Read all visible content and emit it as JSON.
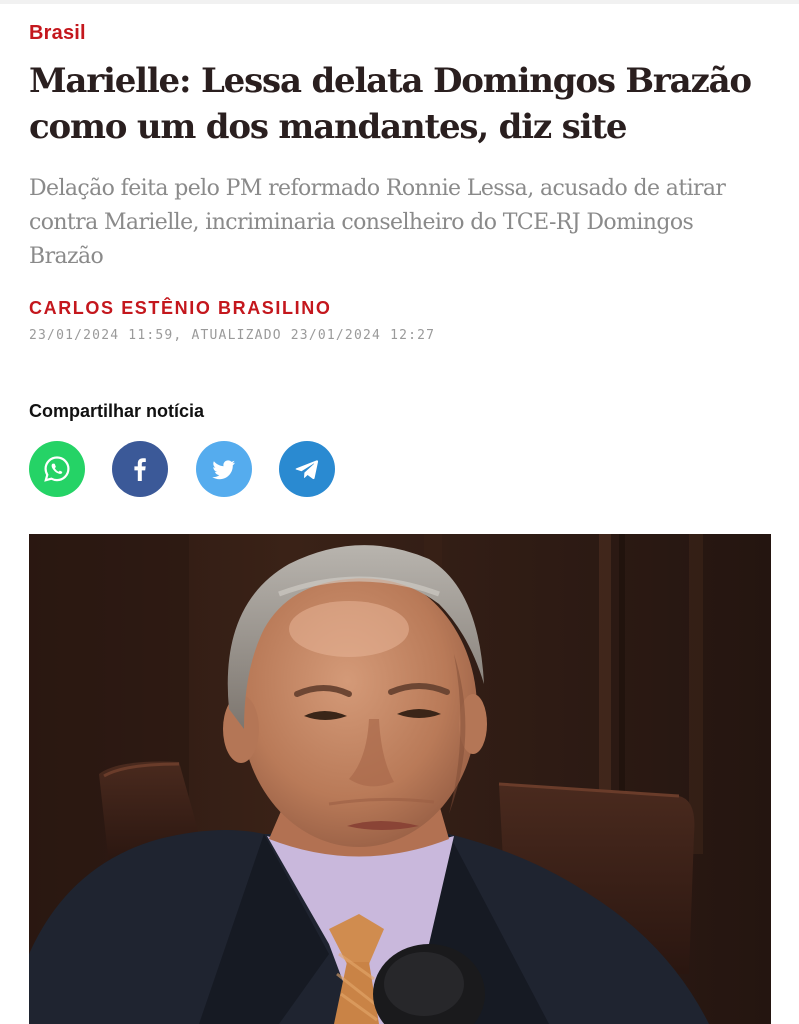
{
  "article": {
    "section": "Brasil",
    "headline": "Marielle: Lessa delata Domingos Brazão como um dos mandantes, diz site",
    "subtitle": "Delação feita pelo PM reformado Ronnie Lessa, acusado de atirar contra Marielle, incriminaria conselheiro do TCE-RJ Domingos Brazão",
    "author": "CARLOS ESTÊNIO BRASILINO",
    "dates": "23/01/2024 11:59, ATUALIZADO 23/01/2024 12:27"
  },
  "share": {
    "label": "Compartilhar notícia",
    "buttons": [
      {
        "name": "whatsapp",
        "icon": "whatsapp-icon",
        "color": "#25d366"
      },
      {
        "name": "facebook",
        "icon": "facebook-icon",
        "color": "#3b5998"
      },
      {
        "name": "twitter",
        "icon": "twitter-icon",
        "color": "#55acee"
      },
      {
        "name": "telegram",
        "icon": "telegram-icon",
        "color": "#2a8ad1"
      }
    ]
  },
  "colors": {
    "accent": "#c4171d",
    "headline": "#2a1f1f",
    "subtitle": "#8a8a8a"
  },
  "photo": {
    "icon": "article-photo"
  }
}
